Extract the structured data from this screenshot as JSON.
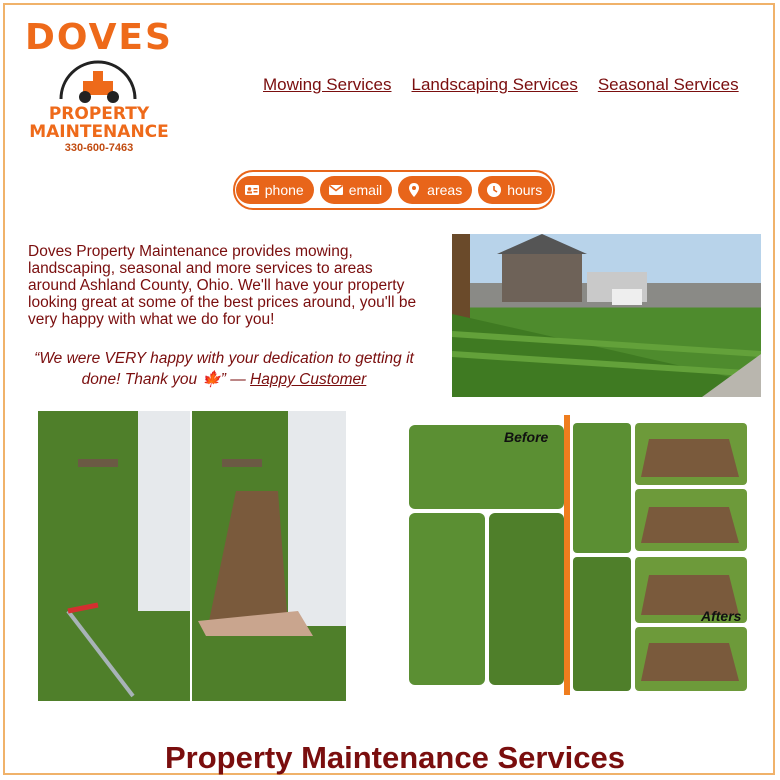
{
  "logo": {
    "brand": "DOVES",
    "line1": "PROPERTY",
    "line2": "MAINTENANCE",
    "phone": "330-600-7463"
  },
  "nav": {
    "items": [
      "Mowing Services",
      "Landscaping Services",
      "Seasonal Services"
    ]
  },
  "contact": {
    "items": [
      {
        "label": "phone",
        "icon": "contact-card-icon"
      },
      {
        "label": "email",
        "icon": "envelope-icon"
      },
      {
        "label": "areas",
        "icon": "map-pin-icon"
      },
      {
        "label": "hours",
        "icon": "clock-icon"
      }
    ]
  },
  "intro": "Doves Property Maintenance provides mowing, landscaping, seasonal and more services to areas around Ashland County, Ohio. We'll have your property looking great at some of the best prices around, you'll be very happy with what we do for you!",
  "testimonial": {
    "quote": "“We were VERY happy with your dedication to getting it done! Thank you 🍁” — ",
    "author": "Happy Customer"
  },
  "collage": {
    "before_label": "Before",
    "after_label": "Afters"
  },
  "section_title": "Property Maintenance Services",
  "colors": {
    "accent": "#e8651a",
    "text": "#7a0e0e",
    "border": "#f0b26a"
  }
}
